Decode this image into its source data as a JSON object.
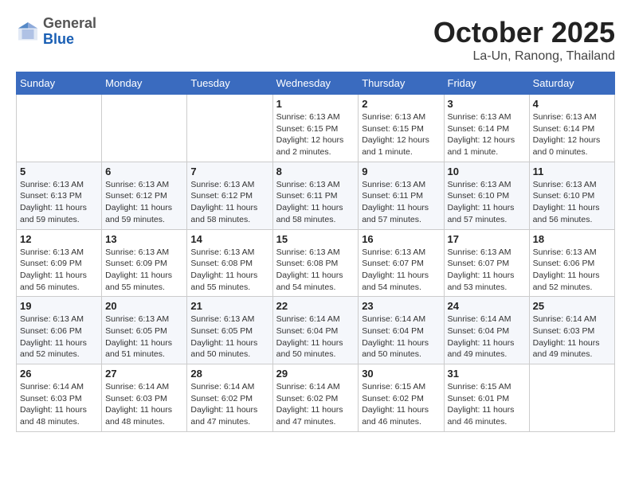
{
  "header": {
    "logo_general": "General",
    "logo_blue": "Blue",
    "month_title": "October 2025",
    "subtitle": "La-Un, Ranong, Thailand"
  },
  "weekdays": [
    "Sunday",
    "Monday",
    "Tuesday",
    "Wednesday",
    "Thursday",
    "Friday",
    "Saturday"
  ],
  "weeks": [
    [
      {
        "day": "",
        "info": ""
      },
      {
        "day": "",
        "info": ""
      },
      {
        "day": "",
        "info": ""
      },
      {
        "day": "1",
        "info": "Sunrise: 6:13 AM\nSunset: 6:15 PM\nDaylight: 12 hours\nand 2 minutes."
      },
      {
        "day": "2",
        "info": "Sunrise: 6:13 AM\nSunset: 6:15 PM\nDaylight: 12 hours\nand 1 minute."
      },
      {
        "day": "3",
        "info": "Sunrise: 6:13 AM\nSunset: 6:14 PM\nDaylight: 12 hours\nand 1 minute."
      },
      {
        "day": "4",
        "info": "Sunrise: 6:13 AM\nSunset: 6:14 PM\nDaylight: 12 hours\nand 0 minutes."
      }
    ],
    [
      {
        "day": "5",
        "info": "Sunrise: 6:13 AM\nSunset: 6:13 PM\nDaylight: 11 hours\nand 59 minutes."
      },
      {
        "day": "6",
        "info": "Sunrise: 6:13 AM\nSunset: 6:12 PM\nDaylight: 11 hours\nand 59 minutes."
      },
      {
        "day": "7",
        "info": "Sunrise: 6:13 AM\nSunset: 6:12 PM\nDaylight: 11 hours\nand 58 minutes."
      },
      {
        "day": "8",
        "info": "Sunrise: 6:13 AM\nSunset: 6:11 PM\nDaylight: 11 hours\nand 58 minutes."
      },
      {
        "day": "9",
        "info": "Sunrise: 6:13 AM\nSunset: 6:11 PM\nDaylight: 11 hours\nand 57 minutes."
      },
      {
        "day": "10",
        "info": "Sunrise: 6:13 AM\nSunset: 6:10 PM\nDaylight: 11 hours\nand 57 minutes."
      },
      {
        "day": "11",
        "info": "Sunrise: 6:13 AM\nSunset: 6:10 PM\nDaylight: 11 hours\nand 56 minutes."
      }
    ],
    [
      {
        "day": "12",
        "info": "Sunrise: 6:13 AM\nSunset: 6:09 PM\nDaylight: 11 hours\nand 56 minutes."
      },
      {
        "day": "13",
        "info": "Sunrise: 6:13 AM\nSunset: 6:09 PM\nDaylight: 11 hours\nand 55 minutes."
      },
      {
        "day": "14",
        "info": "Sunrise: 6:13 AM\nSunset: 6:08 PM\nDaylight: 11 hours\nand 55 minutes."
      },
      {
        "day": "15",
        "info": "Sunrise: 6:13 AM\nSunset: 6:08 PM\nDaylight: 11 hours\nand 54 minutes."
      },
      {
        "day": "16",
        "info": "Sunrise: 6:13 AM\nSunset: 6:07 PM\nDaylight: 11 hours\nand 54 minutes."
      },
      {
        "day": "17",
        "info": "Sunrise: 6:13 AM\nSunset: 6:07 PM\nDaylight: 11 hours\nand 53 minutes."
      },
      {
        "day": "18",
        "info": "Sunrise: 6:13 AM\nSunset: 6:06 PM\nDaylight: 11 hours\nand 52 minutes."
      }
    ],
    [
      {
        "day": "19",
        "info": "Sunrise: 6:13 AM\nSunset: 6:06 PM\nDaylight: 11 hours\nand 52 minutes."
      },
      {
        "day": "20",
        "info": "Sunrise: 6:13 AM\nSunset: 6:05 PM\nDaylight: 11 hours\nand 51 minutes."
      },
      {
        "day": "21",
        "info": "Sunrise: 6:13 AM\nSunset: 6:05 PM\nDaylight: 11 hours\nand 50 minutes."
      },
      {
        "day": "22",
        "info": "Sunrise: 6:14 AM\nSunset: 6:04 PM\nDaylight: 11 hours\nand 50 minutes."
      },
      {
        "day": "23",
        "info": "Sunrise: 6:14 AM\nSunset: 6:04 PM\nDaylight: 11 hours\nand 50 minutes."
      },
      {
        "day": "24",
        "info": "Sunrise: 6:14 AM\nSunset: 6:04 PM\nDaylight: 11 hours\nand 49 minutes."
      },
      {
        "day": "25",
        "info": "Sunrise: 6:14 AM\nSunset: 6:03 PM\nDaylight: 11 hours\nand 49 minutes."
      }
    ],
    [
      {
        "day": "26",
        "info": "Sunrise: 6:14 AM\nSunset: 6:03 PM\nDaylight: 11 hours\nand 48 minutes."
      },
      {
        "day": "27",
        "info": "Sunrise: 6:14 AM\nSunset: 6:03 PM\nDaylight: 11 hours\nand 48 minutes."
      },
      {
        "day": "28",
        "info": "Sunrise: 6:14 AM\nSunset: 6:02 PM\nDaylight: 11 hours\nand 47 minutes."
      },
      {
        "day": "29",
        "info": "Sunrise: 6:14 AM\nSunset: 6:02 PM\nDaylight: 11 hours\nand 47 minutes."
      },
      {
        "day": "30",
        "info": "Sunrise: 6:15 AM\nSunset: 6:02 PM\nDaylight: 11 hours\nand 46 minutes."
      },
      {
        "day": "31",
        "info": "Sunrise: 6:15 AM\nSunset: 6:01 PM\nDaylight: 11 hours\nand 46 minutes."
      },
      {
        "day": "",
        "info": ""
      }
    ]
  ]
}
